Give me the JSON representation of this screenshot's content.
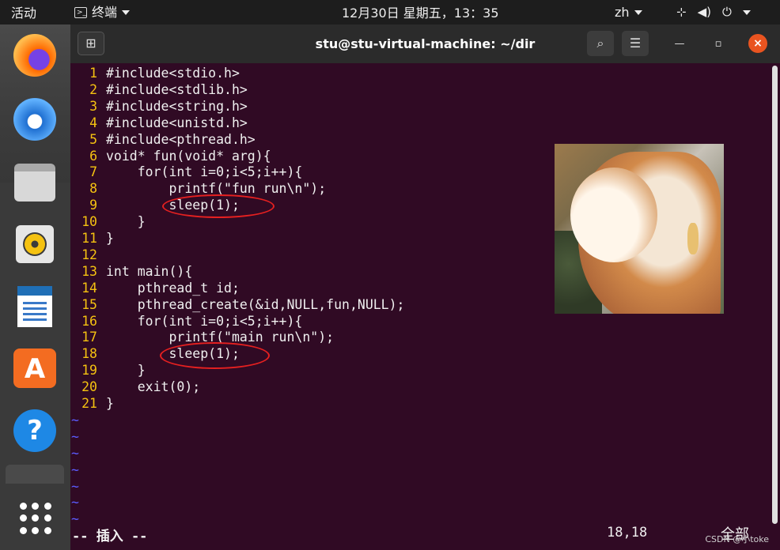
{
  "topbar": {
    "activities": "活动",
    "app_name": "终端",
    "clock": "12月30日 星期五，13：35",
    "language": "zh"
  },
  "dock": {
    "apps": [
      {
        "name": "firefox-icon"
      },
      {
        "name": "thunderbird-icon"
      },
      {
        "name": "files-icon"
      },
      {
        "name": "rhythmbox-icon"
      },
      {
        "name": "libreoffice-writer-icon"
      },
      {
        "name": "software-center-icon"
      },
      {
        "name": "help-icon"
      }
    ],
    "show_apps": "show-applications-icon"
  },
  "window": {
    "title": "stu@stu-virtual-machine: ~/dir"
  },
  "editor": {
    "lines": [
      {
        "n": "1",
        "text": "#include<stdio.h>"
      },
      {
        "n": "2",
        "text": "#include<stdlib.h>"
      },
      {
        "n": "3",
        "text": "#include<string.h>"
      },
      {
        "n": "4",
        "text": "#include<unistd.h>"
      },
      {
        "n": "5",
        "text": "#include<pthread.h>"
      },
      {
        "n": "6",
        "text": "void* fun(void* arg){"
      },
      {
        "n": "7",
        "text": "    for(int i=0;i<5;i++){"
      },
      {
        "n": "8",
        "text": "        printf(\"fun run\\n\");"
      },
      {
        "n": "9",
        "text": "        sleep(1);"
      },
      {
        "n": "10",
        "text": "    }"
      },
      {
        "n": "11",
        "text": "}"
      },
      {
        "n": "12",
        "text": ""
      },
      {
        "n": "13",
        "text": "int main(){"
      },
      {
        "n": "14",
        "text": "    pthread_t id;"
      },
      {
        "n": "15",
        "text": "    pthread_create(&id,NULL,fun,NULL);"
      },
      {
        "n": "16",
        "text": "    for(int i=0;i<5;i++){"
      },
      {
        "n": "17",
        "text": "        printf(\"main run\\n\");"
      },
      {
        "n": "18",
        "text": "        sleep(1);"
      },
      {
        "n": "19",
        "text": "    }"
      },
      {
        "n": "20",
        "text": "    exit(0);"
      },
      {
        "n": "21",
        "text": "}"
      }
    ],
    "tilde_count": 7,
    "tilde": "~",
    "mode": "-- 插入 --",
    "cursor_pos": "18,18",
    "scroll_pos": "全部"
  },
  "watermark": "CSDN @小toke",
  "colors": {
    "terminal_bg": "#300a24",
    "line_number": "#f5c211",
    "annotation_circle": "#e52020",
    "close_button": "#e95420"
  }
}
